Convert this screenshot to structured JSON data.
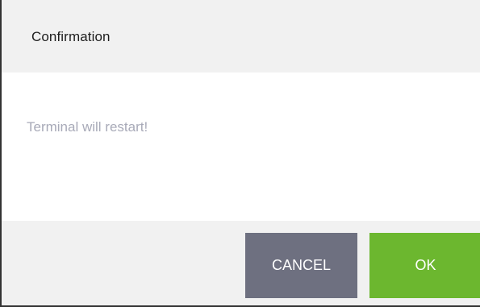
{
  "dialog": {
    "title": "Confirmation",
    "message": "Terminal will restart!",
    "cancel_label": "CANCEL",
    "ok_label": "OK"
  },
  "colors": {
    "header_bg": "#f1f1f1",
    "message_text": "#a8aab8",
    "cancel_button": "#6e7080",
    "ok_button": "#6cb72f"
  }
}
